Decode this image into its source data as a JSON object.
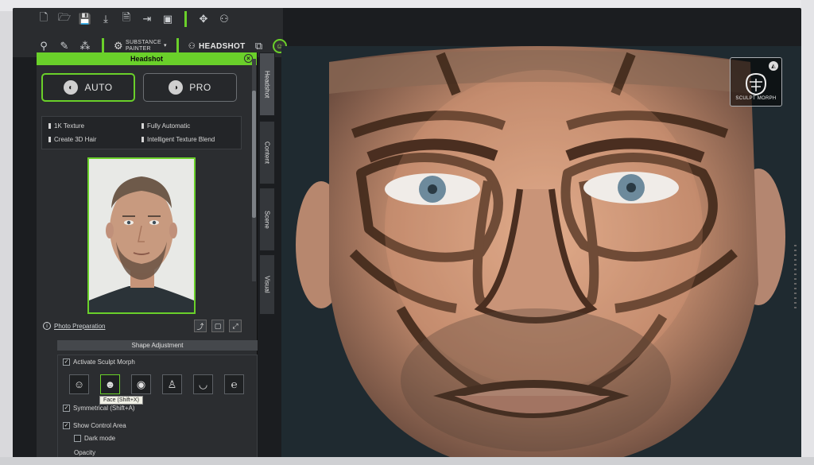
{
  "toolbar": {
    "substance_line1": "SUBSTANCE",
    "substance_line2": "PAINTER",
    "headshot_label": "HEADSHOT"
  },
  "panel": {
    "title": "Headshot",
    "modes": [
      {
        "label": "AUTO",
        "active": true
      },
      {
        "label": "PRO",
        "active": false
      }
    ],
    "features": [
      "1K Texture",
      "Fully Automatic",
      "Create 3D Hair",
      "Intelligent Texture Blend"
    ],
    "photo_prep_label": "Photo Preparation",
    "shape_adjustment_title": "Shape Adjustment",
    "activate_sculpt_label": "Activate Sculpt Morph",
    "face_tooltip": "Face (Shift+X)",
    "symmetrical_label": "Symmetrical (Shift+A)",
    "show_control_area_label": "Show Control Area",
    "dark_mode_label": "Dark mode",
    "opacity_label": "Opacity"
  },
  "tabs": [
    "Headshot",
    "Content",
    "Scene",
    "Visual"
  ],
  "viewport": {
    "badge_label": "SCULPT MORPH"
  },
  "colors": {
    "accent": "#6ad02a",
    "panel_bg": "#2b2d30"
  },
  "icons": [
    "new-file-icon",
    "open-folder-icon",
    "save-icon",
    "import-icon",
    "export-icon",
    "morph-icon",
    "gear-icon",
    "face-part-icon",
    "eye-icon",
    "nose-icon",
    "mouth-icon",
    "ear-icon"
  ]
}
